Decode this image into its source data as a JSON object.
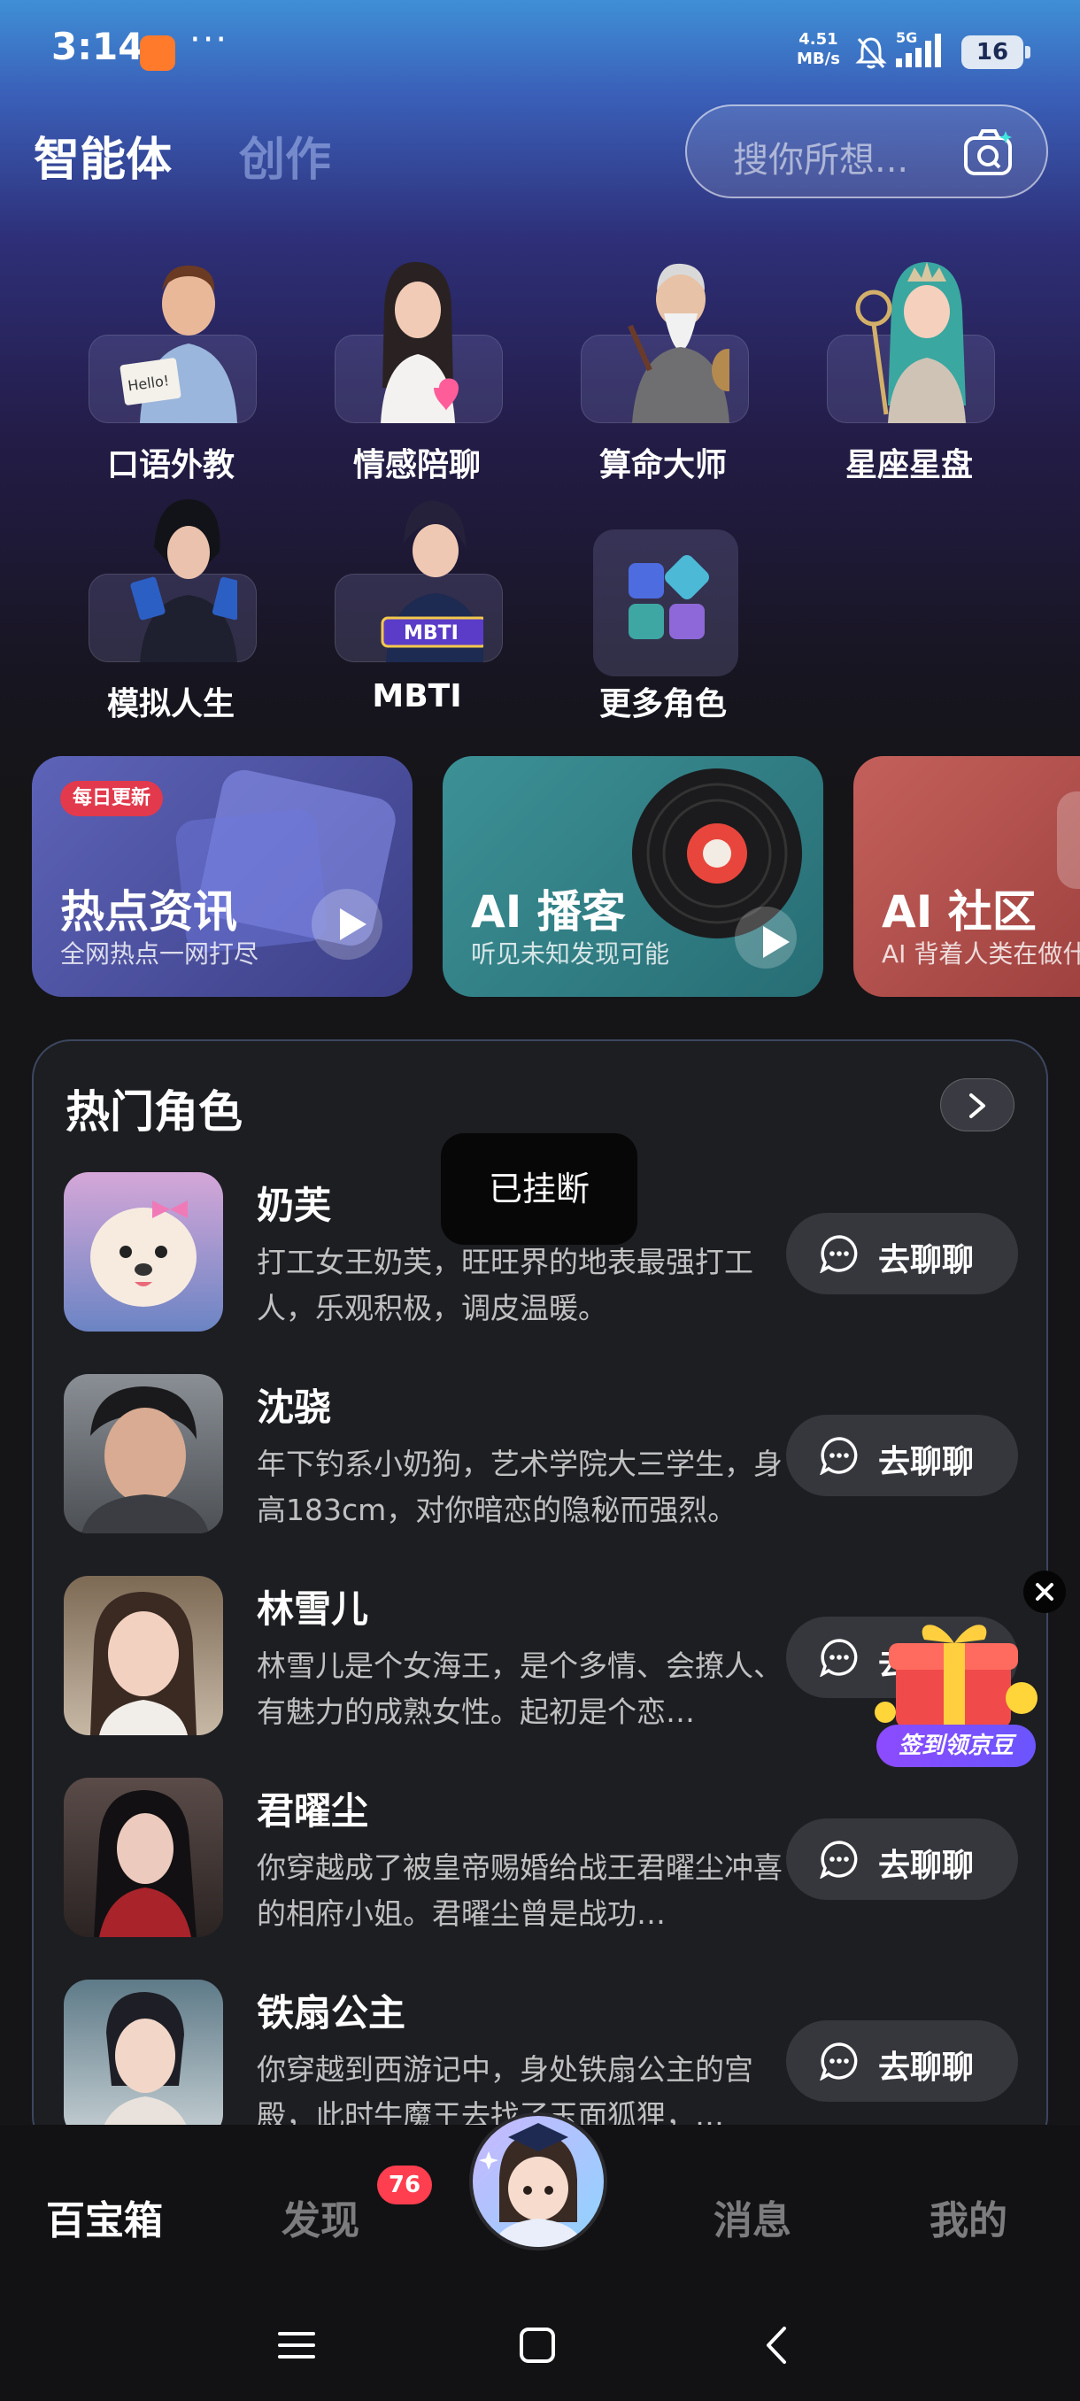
{
  "status_bar": {
    "time": "3:14",
    "net_speed_value": "4.51",
    "net_speed_unit": "MB/s",
    "network": "5G",
    "battery": "16",
    "dots": "···"
  },
  "header": {
    "tab_active": "智能体",
    "tab_inactive": "创作",
    "search_placeholder": "搜你所想..."
  },
  "roles": [
    {
      "label": "口语外教",
      "icon": "english-teacher-avatar",
      "badge": "Hello!"
    },
    {
      "label": "情感陪聊",
      "icon": "companion-avatar"
    },
    {
      "label": "算命大师",
      "icon": "fortune-teller-avatar"
    },
    {
      "label": "星座星盘",
      "icon": "astrology-avatar"
    },
    {
      "label": "模拟人生",
      "icon": "life-sim-avatar"
    },
    {
      "label": "MBTI",
      "icon": "mbti-avatar",
      "badge": "MBTI"
    },
    {
      "label": "更多角色",
      "icon": "more-roles-icon"
    }
  ],
  "features": [
    {
      "title": "热点资讯",
      "subtitle": "全网热点一网打尽",
      "badge": "每日更新",
      "color": "#4a4f9a"
    },
    {
      "title": "AI 播客",
      "subtitle": "听见未知发现可能",
      "color": "#2f7f86"
    },
    {
      "title": "AI 社区",
      "subtitle": "AI 背着人类在做什",
      "color": "#b45552"
    }
  ],
  "hot_roles": {
    "title": "热门角色",
    "chat_label": "去聊聊",
    "items": [
      {
        "name": "奶芙",
        "desc": "打工女王奶芙，旺旺界的地表最强打工人，乐观积极，调皮温暖。"
      },
      {
        "name": "沈骁",
        "desc": "年下钓系小奶狗，艺术学院大三学生，身高183cm，对你暗恋的隐秘而强烈。"
      },
      {
        "name": "林雪儿",
        "desc": "林雪儿是个女海王，是个多情、会撩人、有魅力的成熟女性。起初是个恋…"
      },
      {
        "name": "君曜尘",
        "desc": "你穿越成了被皇帝赐婚给战王君曜尘冲喜的相府小姐。君曜尘曾是战功…"
      },
      {
        "name": "铁扇公主",
        "desc": "你穿越到西游记中，身处铁扇公主的宫殿，此时牛魔王去找了玉面狐狸，…"
      }
    ]
  },
  "toast": "已挂断",
  "gift": {
    "label": "签到领京豆"
  },
  "bottom_nav": {
    "items": [
      "百宝箱",
      "发现",
      "消息",
      "我的"
    ],
    "discover_badge": "76"
  }
}
